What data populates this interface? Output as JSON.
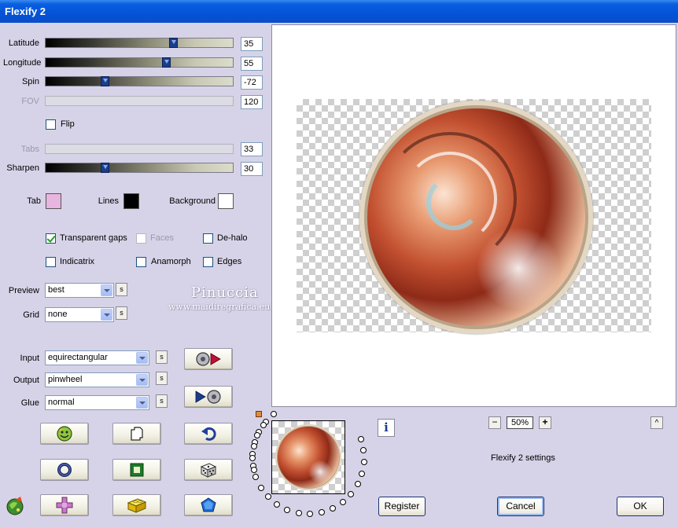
{
  "window": {
    "title": "Flexify 2"
  },
  "sliders": {
    "latitude": {
      "label": "Latitude",
      "value": "35",
      "fraction": 0.69
    },
    "longitude": {
      "label": "Longitude",
      "value": "55",
      "fraction": 0.65
    },
    "spin": {
      "label": "Spin",
      "value": "-72",
      "fraction": 0.31
    },
    "fov": {
      "label": "FOV",
      "value": "120",
      "disabled": true
    },
    "tabs": {
      "label": "Tabs",
      "value": "33",
      "disabled": true
    },
    "sharpen": {
      "label": "Sharpen",
      "value": "30",
      "fraction": 0.31
    }
  },
  "flip": {
    "label": "Flip",
    "checked": false
  },
  "colors": {
    "tab": {
      "label": "Tab",
      "color": "#e8b4e0"
    },
    "lines": {
      "label": "Lines",
      "color": "#000000"
    },
    "background": {
      "label": "Background",
      "color": "#ffffff"
    }
  },
  "options": {
    "transparent_gaps": {
      "label": "Transparent gaps",
      "checked": true
    },
    "faces": {
      "label": "Faces",
      "checked": false,
      "disabled": true
    },
    "de_halo": {
      "label": "De-halo",
      "checked": false
    },
    "indicatrix": {
      "label": "Indicatrix",
      "checked": false
    },
    "anamorph": {
      "label": "Anamorph",
      "checked": false
    },
    "edges": {
      "label": "Edges",
      "checked": false
    }
  },
  "preview_select": {
    "label": "Preview",
    "value": "best",
    "s": "s"
  },
  "grid_select": {
    "label": "Grid",
    "value": "none",
    "s": "s"
  },
  "input_select": {
    "label": "Input",
    "value": "equirectangular",
    "s": "s"
  },
  "output_select": {
    "label": "Output",
    "value": "pinwheel",
    "s": "s"
  },
  "glue_select": {
    "label": "Glue",
    "value": "normal",
    "s": "s"
  },
  "watermark": {
    "line1": "Pinuccia",
    "line2": "www.maidiregrafica.eu"
  },
  "zoom": {
    "minus": "−",
    "value": "50%",
    "plus": "+"
  },
  "info": {
    "label": "i"
  },
  "collapse": {
    "label": "^"
  },
  "status": {
    "text": "Flexify 2 settings"
  },
  "buttons": {
    "register": "Register",
    "cancel": "Cancel",
    "ok": "OK"
  },
  "icons": {
    "to_output": "disc-arrow-right-icon",
    "to_input": "arrow-disc-icon",
    "randomize_face": "smiley-icon",
    "copy": "copy-pages-icon",
    "undo": "undo-arrow-icon",
    "ring": "ring-icon",
    "frame": "square-frame-icon",
    "dice": "dice-icon",
    "cross": "cross-shape-icon",
    "cube": "cube-icon",
    "pentagon": "pentagon-icon"
  }
}
